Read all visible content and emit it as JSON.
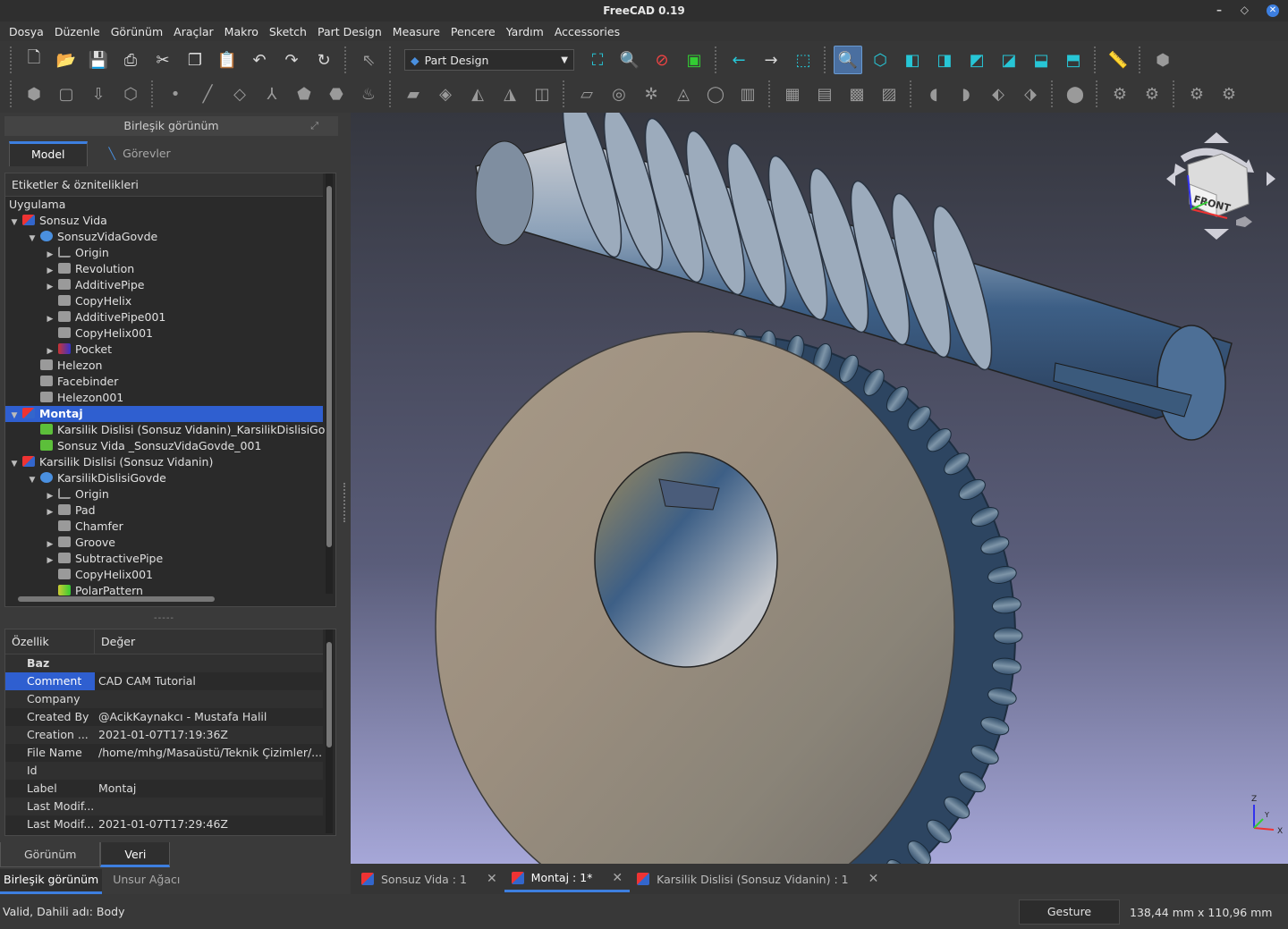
{
  "window": {
    "title": "FreeCAD 0.19"
  },
  "menu": [
    "Dosya",
    "Düzenle",
    "Görünüm",
    "Araçlar",
    "Makro",
    "Sketch",
    "Part Design",
    "Measure",
    "Pencere",
    "Yardım",
    "Accessories"
  ],
  "toolbar": {
    "workbench": "Part Design"
  },
  "combo_view": {
    "title": "Birleşik görünüm",
    "tab_model": "Model",
    "tab_tasks": "Görevler",
    "tree_header": "Etiketler & öznitelikleri",
    "section": "Uygulama",
    "tree": [
      {
        "label": "Sonsuz Vida",
        "level": 0,
        "icon": "doc",
        "expand": "open"
      },
      {
        "label": "SonsuzVidaGovde",
        "level": 1,
        "icon": "body",
        "expand": "open"
      },
      {
        "label": "Origin",
        "level": 2,
        "icon": "axis",
        "expand": "closed"
      },
      {
        "label": "Revolution",
        "level": 2,
        "icon": "feat",
        "expand": "closed"
      },
      {
        "label": "AdditivePipe",
        "level": 2,
        "icon": "feat",
        "expand": "closed"
      },
      {
        "label": "CopyHelix",
        "level": 2,
        "icon": "feat",
        "expand": "none"
      },
      {
        "label": "AdditivePipe001",
        "level": 2,
        "icon": "feat",
        "expand": "closed"
      },
      {
        "label": "CopyHelix001",
        "level": 2,
        "icon": "feat",
        "expand": "none"
      },
      {
        "label": "Pocket",
        "level": 2,
        "icon": "pocket",
        "expand": "closed"
      },
      {
        "label": "Helezon",
        "level": 1,
        "icon": "feat",
        "expand": "none"
      },
      {
        "label": "Facebinder",
        "level": 1,
        "icon": "feat",
        "expand": "none"
      },
      {
        "label": "Helezon001",
        "level": 1,
        "icon": "feat",
        "expand": "none"
      },
      {
        "label": "Montaj",
        "level": 0,
        "icon": "doc",
        "expand": "open",
        "selected": true
      },
      {
        "label": "Karsilik Dislisi (Sonsuz Vidanin)_KarsilikDislisiGo",
        "level": 1,
        "icon": "link",
        "expand": "none"
      },
      {
        "label": "Sonsuz Vida _SonsuzVidaGovde_001",
        "level": 1,
        "icon": "link",
        "expand": "none"
      },
      {
        "label": "Karsilik Dislisi (Sonsuz Vidanin)",
        "level": 0,
        "icon": "doc",
        "expand": "open"
      },
      {
        "label": "KarsilikDislisiGovde",
        "level": 1,
        "icon": "body",
        "expand": "open"
      },
      {
        "label": "Origin",
        "level": 2,
        "icon": "axis",
        "expand": "closed"
      },
      {
        "label": "Pad",
        "level": 2,
        "icon": "feat",
        "expand": "closed"
      },
      {
        "label": "Chamfer",
        "level": 2,
        "icon": "feat",
        "expand": "none"
      },
      {
        "label": "Groove",
        "level": 2,
        "icon": "feat",
        "expand": "closed"
      },
      {
        "label": "SubtractivePipe",
        "level": 2,
        "icon": "feat",
        "expand": "closed"
      },
      {
        "label": "CopyHelix001",
        "level": 2,
        "icon": "feat",
        "expand": "none"
      },
      {
        "label": "PolarPattern",
        "level": 2,
        "icon": "polar",
        "expand": "none"
      }
    ],
    "props_header_prop": "Özellik",
    "props_header_val": "Değer",
    "props_group": "Baz",
    "props": [
      {
        "k": "Comment",
        "v": "CAD CAM Tutorial",
        "selected": true
      },
      {
        "k": "Company",
        "v": ""
      },
      {
        "k": "Created By",
        "v": "@AcikKaynakcı - Mustafa Halil"
      },
      {
        "k": "Creation ...",
        "v": "2021-01-07T17:19:36Z"
      },
      {
        "k": "File Name",
        "v": "/home/mhg/Masaüstü/Teknik Çizimler/..."
      },
      {
        "k": "Id",
        "v": ""
      },
      {
        "k": "Label",
        "v": "Montaj"
      },
      {
        "k": "Last Modif...",
        "v": ""
      },
      {
        "k": "Last Modif...",
        "v": "2021-01-07T17:29:46Z"
      }
    ],
    "tab_view": "Görünüm",
    "tab_data": "Veri",
    "tab_combo": "Birleşik görünüm",
    "tab_tree": "Unsur Ağacı"
  },
  "navcube": {
    "face": "FRONT",
    "axis_x": "X",
    "axis_z": "Z",
    "axis_y": "Y"
  },
  "doc_tabs": [
    {
      "label": "Sonsuz Vida  : 1",
      "active": false
    },
    {
      "label": "Montaj : 1*",
      "active": true
    },
    {
      "label": "Karsilik Dislisi (Sonsuz Vidanin) : 1",
      "active": false
    }
  ],
  "status": {
    "message": "Valid, Dahili adı: Body",
    "nav_style": "Gesture",
    "dimensions": "138,44 mm x 110,96 mm"
  }
}
